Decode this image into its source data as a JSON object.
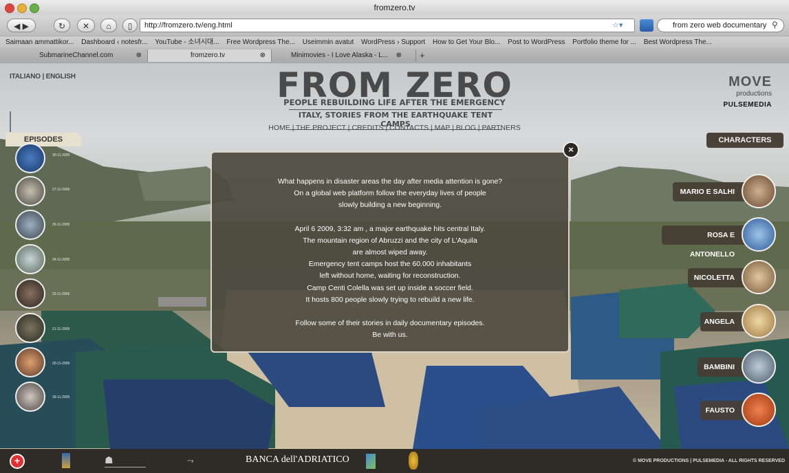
{
  "browser": {
    "window_title": "fromzero.tv",
    "url": "http://fromzero.tv/eng.html",
    "search_query": "from zero web documentary",
    "bookmarks": [
      "Saimaan ammattikor...",
      "Dashboard ‹ notesfr...",
      "YouTube - 소녀시대...",
      "Free Wordpress The...",
      "Useimmin avatut",
      "WordPress › Support",
      "How to Get Your Blo...",
      "Post to WordPress",
      "Portfolio theme for ...",
      "Best Wordpress The..."
    ],
    "tabs": [
      "SubmarineChannel.com",
      "fromzero.tv",
      "Minimovies - I Love Alaska - L..."
    ]
  },
  "site": {
    "lang_italiano": "ITALIANO",
    "lang_sep": "|",
    "lang_english": "ENGLISH",
    "logo_title": "FROM ZERO",
    "logo_subtitle": "PEOPLE REBUILDING LIFE AFTER THE EMERGENCY",
    "logo_subtitle2": "ITALY, STORIES FROM THE EARTHQUAKE TENT CAMPS",
    "nav": "HOME | THE PROJECT | CREDITS | CONTACTS | MAP | BLOG | PARTNERS",
    "move_logo": "MOVE",
    "move_sub": "productions",
    "pulse_logo": "PULSEMEDIA",
    "episodes_label": "EPISODES",
    "characters_label": "CHARACTERS"
  },
  "episodes": [
    {
      "date": "30-11-2009"
    },
    {
      "date": "27-11-2009"
    },
    {
      "date": "26-11-2009"
    },
    {
      "date": "24-11-2009"
    },
    {
      "date": "23-11-2009"
    },
    {
      "date": "21-11-2009"
    },
    {
      "date": "20-11-2009"
    },
    {
      "date": "18-11-2009"
    }
  ],
  "characters": [
    {
      "name": "MARIO E SALHI",
      "color": "#8a6a4a"
    },
    {
      "name": "ROSA E ANTONELLO",
      "color": "#5e8cc4"
    },
    {
      "name": "NICOLETTA",
      "color": "#b8956a"
    },
    {
      "name": "ANGELA",
      "color": "#d6b070"
    },
    {
      "name": "BAMBINI",
      "color": "#7a8ca0"
    },
    {
      "name": "FAUSTO",
      "color": "#d46a30"
    }
  ],
  "modal": {
    "lines": [
      "What happens in disaster areas the day after media attention is gone?",
      "On a global web platform follow the everyday lives of people",
      "slowly building a new beginning.",
      "",
      "April 6  2009, 3:32 am , a major earthquake hits central Italy.",
      "The mountain region of Abruzzi and the city of L'Aquila",
      "are almost wiped away.",
      "Emergency tent camps host the 60.000 inhabitants",
      "left without home, waiting for reconstruction.",
      "Camp Centi Colella was set up inside a soccer field.",
      "It hosts 800 people slowly trying to rebuild a new life.",
      "",
      "Follow some of their stories in daily documentary episodes.",
      "Be with us."
    ],
    "close_label": "×"
  },
  "footer": {
    "banca": "BANCA dell'ADRIATICO",
    "copyright": "© MOVE PRODUCTIONS | PULSEMEDIA - ALL RIGHTS RESERVED"
  },
  "colors": {
    "tent_blue": "#2a4a80",
    "tent_green": "#2d5a4a",
    "modal_bg": "#4e4a40"
  }
}
